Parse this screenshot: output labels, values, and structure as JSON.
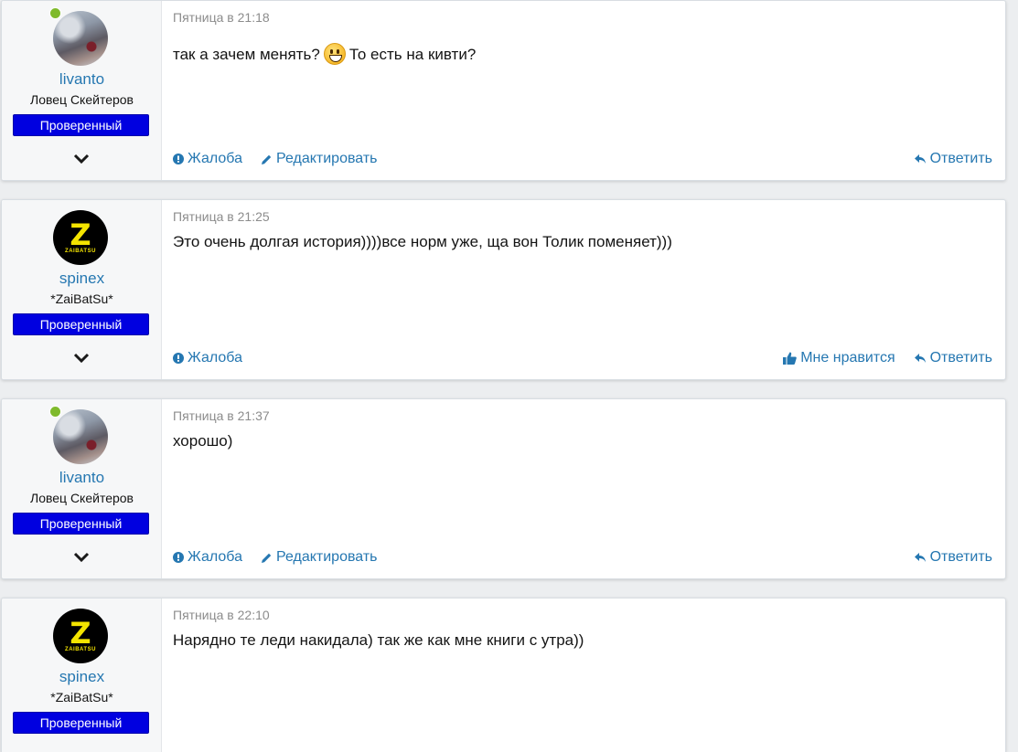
{
  "posts": [
    {
      "username": "livanto",
      "usertitle": "Ловец Скейтеров",
      "badge": "Проверенный",
      "online": true,
      "avatar": "photo",
      "date": "Пятница в 21:18",
      "text_before_emoji": "так а зачем менять?",
      "emoji": "grinning-face",
      "text_after_emoji": "То есть на кивти?",
      "actions_left": [
        "Жалоба",
        "Редактировать"
      ],
      "actions_right": [
        "Ответить"
      ]
    },
    {
      "username": "spinex",
      "usertitle": "*ZaiBatSu*",
      "badge": "Проверенный",
      "online": false,
      "avatar": "logo",
      "avatar_text": {
        "letter": "Z",
        "word": "ZAIBATSU"
      },
      "date": "Пятница в 21:25",
      "text": "Это очень долгая история))))все норм уже, ща вон Толик поменяет)))",
      "actions_left": [
        "Жалоба"
      ],
      "actions_right": [
        "Мне нравится",
        "Ответить"
      ]
    },
    {
      "username": "livanto",
      "usertitle": "Ловец Скейтеров",
      "badge": "Проверенный",
      "online": true,
      "avatar": "photo",
      "date": "Пятница в 21:37",
      "text": "хорошо)",
      "actions_left": [
        "Жалоба",
        "Редактировать"
      ],
      "actions_right": [
        "Ответить"
      ]
    },
    {
      "username": "spinex",
      "usertitle": "*ZaiBatSu*",
      "badge": "Проверенный",
      "online": false,
      "avatar": "logo",
      "avatar_text": {
        "letter": "Z",
        "word": "ZAIBATSU"
      },
      "date": "Пятница в 22:10",
      "text": "Нарядно те леди накидала) так же как мне книги с утра))"
    }
  ],
  "colors": {
    "link": "#2577b1",
    "badge": "#0000e0",
    "online": "#7fba2c",
    "date": "#8c8c8c"
  }
}
